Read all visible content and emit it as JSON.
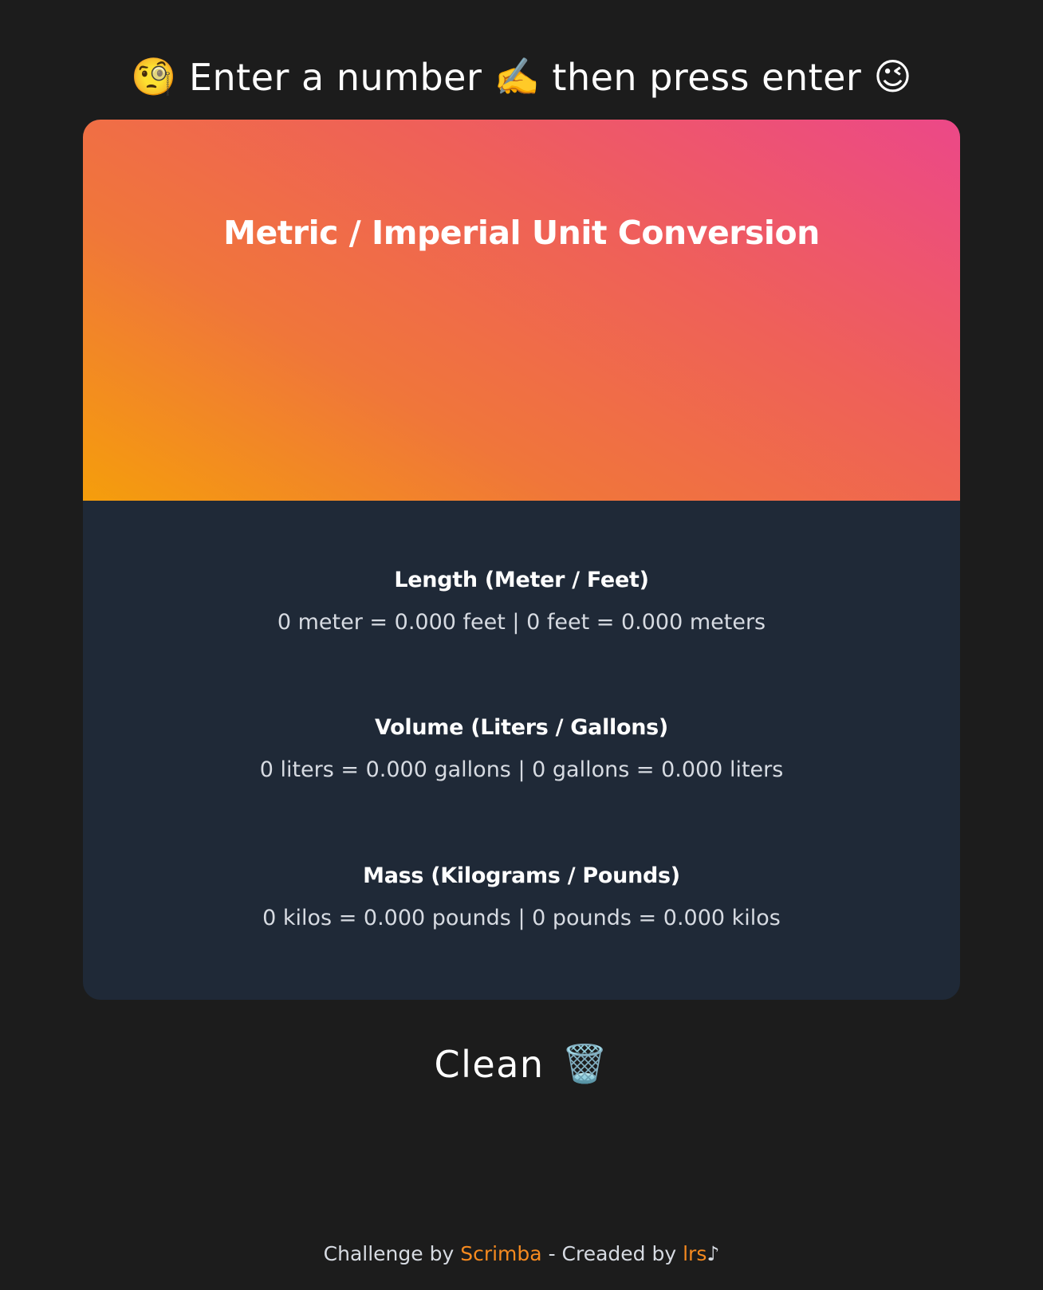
{
  "prompt": {
    "emoji_left": "🧐",
    "text_part1": "Enter a number",
    "emoji_middle": "✍️",
    "text_part2": "then press enter",
    "emoji_right": "😉"
  },
  "card": {
    "title": "Metric / Imperial Unit Conversion",
    "input_value": "",
    "gradient_colors": [
      "#f59e0b",
      "#f0763a",
      "#ef6059",
      "#ec4888"
    ],
    "panel_color": "#1f2937"
  },
  "sections": [
    {
      "title": "Length (Meter / Feet)",
      "text": "0 meter = 0.000 feet | 0 feet = 0.000 meters"
    },
    {
      "title": "Volume (Liters / Gallons)",
      "text": "0 liters = 0.000 gallons | 0 gallons = 0.000 liters"
    },
    {
      "title": "Mass (Kilograms / Pounds)",
      "text": "0 kilos = 0.000 pounds | 0 pounds = 0.000 kilos"
    }
  ],
  "clean_button": {
    "label": "Clean",
    "icon": "🗑️"
  },
  "footer": {
    "prefix": "Challenge by",
    "link1": "Scrimba",
    "middle": "- Creaded by",
    "link2": "lrs",
    "suffix": "♪",
    "link_color": "#f68a1f"
  },
  "colors": {
    "background": "#1c1c1c",
    "text_muted": "#d7dbe2"
  }
}
